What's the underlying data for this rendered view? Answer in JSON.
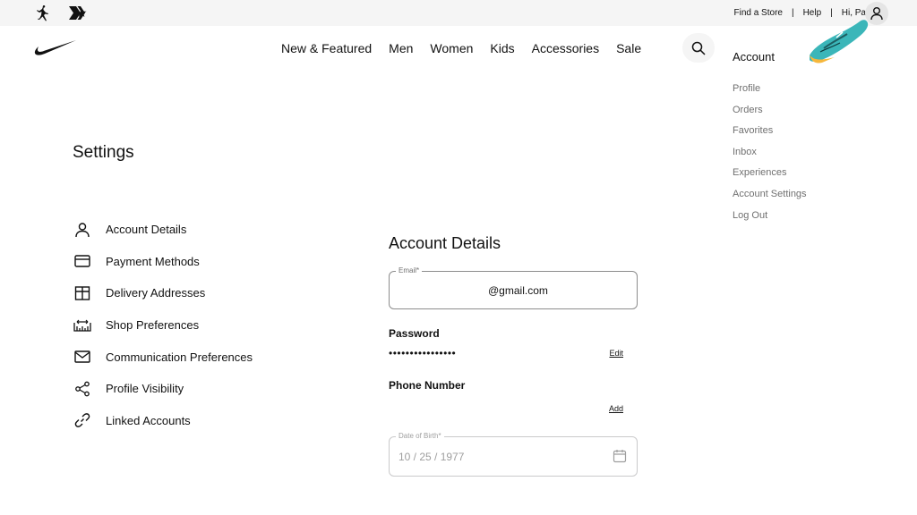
{
  "utility": {
    "find_store": "Find a Store",
    "help": "Help",
    "greeting": "Hi, Paz",
    "separator": "|"
  },
  "icons": {
    "jordan": "jordan-logo-icon",
    "converse": "converse-logo-icon",
    "nike": "nike-swoosh-icon",
    "account": "user-icon",
    "search": "search-icon"
  },
  "nav": {
    "items": [
      "New & Featured",
      "Men",
      "Women",
      "Kids",
      "Accessories",
      "Sale"
    ]
  },
  "account_menu": {
    "heading": "Account",
    "items": [
      "Profile",
      "Orders",
      "Favorites",
      "Inbox",
      "Experiences",
      "Account Settings",
      "Log Out"
    ]
  },
  "settings": {
    "title": "Settings",
    "menu": [
      {
        "label": "Account Details",
        "icon": "user-icon"
      },
      {
        "label": "Payment Methods",
        "icon": "card-icon"
      },
      {
        "label": "Delivery Addresses",
        "icon": "package-icon"
      },
      {
        "label": "Shop Preferences",
        "icon": "ruler-icon"
      },
      {
        "label": "Communication Preferences",
        "icon": "mail-icon"
      },
      {
        "label": "Profile Visibility",
        "icon": "share-icon"
      },
      {
        "label": "Linked Accounts",
        "icon": "link-icon"
      }
    ]
  },
  "details": {
    "title": "Account Details",
    "email_label": "Email*",
    "email_value": "@gmail.com",
    "password_label": "Password",
    "password_value": "••••••••••••••••",
    "edit": "Edit",
    "phone_label": "Phone Number",
    "add": "Add",
    "dob_label": "Date of Birth*",
    "dob_value": "10 / 25 / 1977"
  },
  "colors": {
    "accent_shoe_teal": "#3bb6b9",
    "accent_shoe_yellow": "#f6b73c"
  }
}
